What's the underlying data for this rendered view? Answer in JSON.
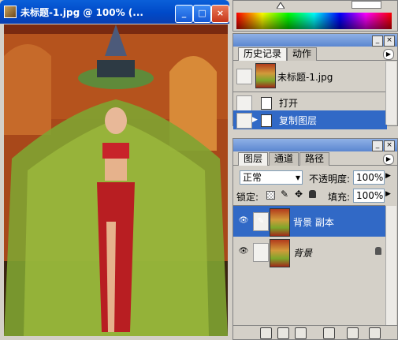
{
  "document": {
    "title": "未标题-1.jpg @ 100% (...",
    "buttons": {
      "minimize": "_",
      "maximize": "□",
      "close": "×"
    }
  },
  "colors": {
    "titlebar": "#0050d0",
    "panel_bar": "#6a93d8",
    "selection": "#3169c6",
    "panel_bg": "#d4d0c8"
  },
  "history_panel": {
    "tabs": [
      {
        "label": "历史记录"
      },
      {
        "label": "动作"
      }
    ],
    "snapshot": {
      "label": "未标题-1.jpg"
    },
    "states": [
      {
        "label": "打开",
        "selected": false
      },
      {
        "label": "复制图层",
        "selected": true
      }
    ]
  },
  "layers_panel": {
    "tabs": [
      {
        "label": "图层"
      },
      {
        "label": "通道"
      },
      {
        "label": "路径"
      }
    ],
    "blend_mode": "正常",
    "opacity_label": "不透明度:",
    "opacity_value": "100%",
    "lock_label": "锁定:",
    "fill_label": "填充:",
    "fill_value": "100%",
    "layers": [
      {
        "name": "背景 副本",
        "selected": true,
        "locked": false
      },
      {
        "name": "背景",
        "selected": false,
        "locked": true
      }
    ]
  },
  "icons": [
    "eye-icon",
    "brush-icon",
    "lock-icon",
    "trash-icon",
    "new-layer-icon",
    "mask-icon",
    "link-icon",
    "folder-icon",
    "adjustment-icon",
    "fx-icon",
    "menu-arrow-icon"
  ]
}
